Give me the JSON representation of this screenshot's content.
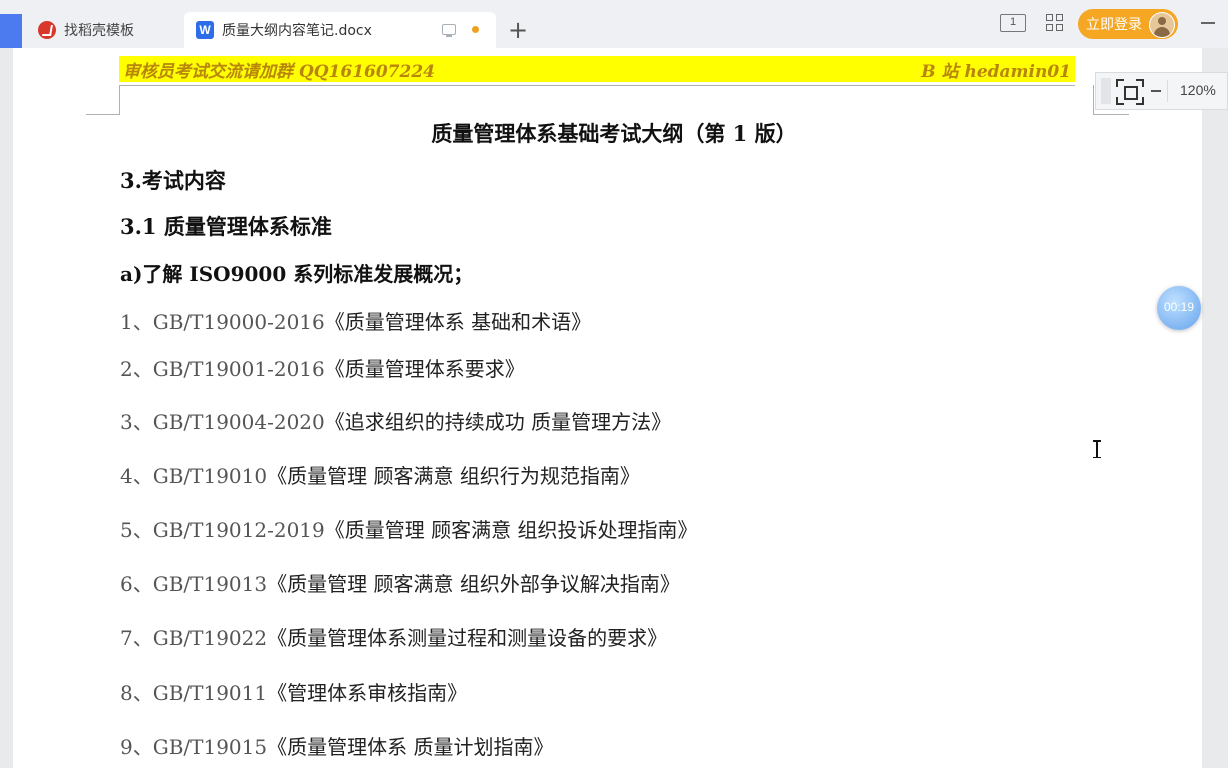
{
  "tabs": [
    {
      "label": "找稻壳模板",
      "icon": "docer-icon"
    },
    {
      "label": "质量大纲内容笔记.docx",
      "icon": "word-doc-icon"
    }
  ],
  "toolbar": {
    "layout_icon_text": "1",
    "login_label": "立即登录"
  },
  "header_banner": {
    "left": "审核员考试交流请加群 QQ161607224",
    "right": "B 站 hedamin01",
    "background": "#ffff00",
    "text_color": "#b8860b"
  },
  "document": {
    "title": "质量管理体系基础考试大纲（第 1 版）",
    "section": "3.考试内容",
    "subsection": "3.1 质量管理体系标准",
    "point": "a)了解 ISO9000 系列标准发展概况；",
    "items": [
      {
        "prefix": "1、GB/T19000-2016",
        "title": "《质量管理体系 基础和术语》"
      },
      {
        "prefix": "2、GB/T19001-2016",
        "title": "《质量管理体系要求》"
      },
      {
        "prefix": "3、GB/T19004-2020",
        "title": "《追求组织的持续成功 质量管理方法》"
      },
      {
        "prefix": "4、GB/T19010",
        "title": "《质量管理 顾客满意 组织行为规范指南》"
      },
      {
        "prefix": "5、GB/T19012-2019",
        "title": "《质量管理 顾客满意 组织投诉处理指南》"
      },
      {
        "prefix": "6、GB/T19013",
        "title": "《质量管理 顾客满意 组织外部争议解决指南》"
      },
      {
        "prefix": "7、GB/T19022",
        "title": "《质量管理体系测量过程和测量设备的要求》"
      },
      {
        "prefix": "8、GB/T19011",
        "title": "《管理体系审核指南》"
      },
      {
        "prefix": "9、GB/T19015",
        "title": "《质量管理体系 质量计划指南》"
      }
    ]
  },
  "zoom": {
    "level": "120%"
  },
  "timer": {
    "value": "00:19"
  }
}
